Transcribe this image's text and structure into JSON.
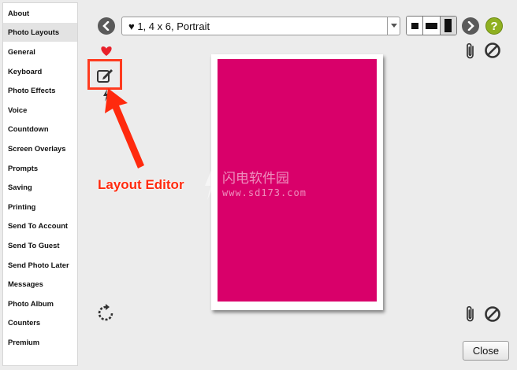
{
  "sidebar": {
    "items": [
      {
        "label": "About",
        "selected": false
      },
      {
        "label": "Photo Layouts",
        "selected": true
      },
      {
        "label": "General",
        "selected": false
      },
      {
        "label": "Keyboard",
        "selected": false
      },
      {
        "label": "Photo Effects",
        "selected": false
      },
      {
        "label": "Voice",
        "selected": false
      },
      {
        "label": "Countdown",
        "selected": false
      },
      {
        "label": "Screen Overlays",
        "selected": false
      },
      {
        "label": "Prompts",
        "selected": false
      },
      {
        "label": "Saving",
        "selected": false
      },
      {
        "label": "Printing",
        "selected": false
      },
      {
        "label": "Send To Account",
        "selected": false
      },
      {
        "label": "Send To Guest",
        "selected": false
      },
      {
        "label": "Send Photo Later",
        "selected": false
      },
      {
        "label": "Messages",
        "selected": false
      },
      {
        "label": "Photo Album",
        "selected": false
      },
      {
        "label": "Counters",
        "selected": false
      },
      {
        "label": "Premium",
        "selected": false
      }
    ]
  },
  "toolbar": {
    "prev_icon": "chevron-left-icon",
    "layout_select_value": "♥ 1, 4 x 6, Portrait",
    "next_icon": "chevron-right-icon",
    "help_label": "?",
    "view_modes": [
      "small-landscape",
      "wide-landscape",
      "portrait"
    ],
    "active_view_mode": "portrait"
  },
  "annotation": {
    "label": "Layout Editor",
    "color": "#ff2a0e"
  },
  "watermark": {
    "main": "闪电软件园",
    "sub": "www.sd173.com"
  },
  "canvas": {
    "photo_color": "#d9006a"
  },
  "footer": {
    "close_label": "Close"
  }
}
